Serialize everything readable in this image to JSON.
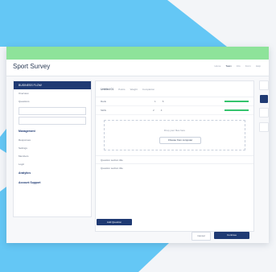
{
  "app": {
    "title": "Sport Survey"
  },
  "breadcrumbs": [
    "Home",
    "Team",
    "Info",
    "Form",
    "Help"
  ],
  "sidebar": {
    "header": "BUSINESS FLOW",
    "items": [
      "Overview",
      "Questions",
      "Responses",
      "Settings",
      "Members",
      "Logic",
      "Reports"
    ],
    "sections": [
      "Management",
      "Analytics",
      "Account Support"
    ]
  },
  "main": {
    "question_title": "Untitled 01",
    "columns": [
      "Points",
      "Weight",
      "Completion"
    ],
    "rows": [
      {
        "label": "Rank",
        "a": "1",
        "b": "6"
      },
      {
        "label": "Skills",
        "a": "2",
        "b": "4"
      }
    ],
    "upload": {
      "text": "Drop your files here",
      "button": "Choose from computer"
    },
    "sections": [
      "Question section title",
      "Question section title"
    ],
    "add_button": "Add Question"
  },
  "footer": {
    "cancel": "Cancel",
    "next": "Continue"
  },
  "colors": {
    "accent": "#1f3a73",
    "green": "#8ee39a",
    "bg": "#f3f5f8",
    "shape": "#64c7f5"
  }
}
